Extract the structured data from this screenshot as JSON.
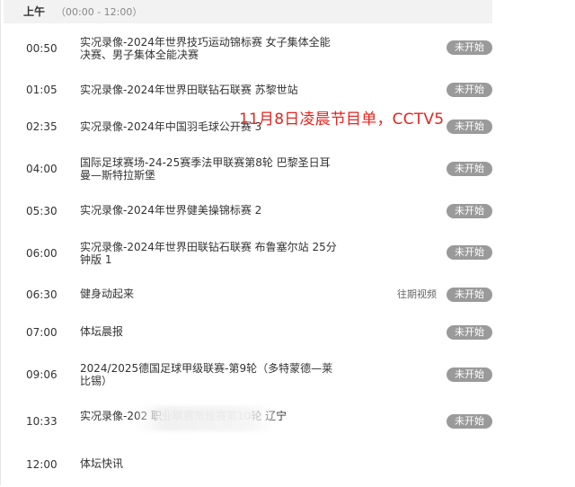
{
  "period": {
    "label": "上午",
    "range": "（00:00 - 12:00）"
  },
  "overlay_caption": "11月8日凌晨节目单，CCTV5",
  "programs": [
    {
      "time": "00:50",
      "title": "实况录像-2024年世界技巧运动锦标赛 女子集体全能决赛、男子集体全能决赛",
      "status": "未开始"
    },
    {
      "time": "01:05",
      "title": "实况录像-2024年世界田联钻石联赛 苏黎世站",
      "status": "未开始"
    },
    {
      "time": "02:35",
      "title": "实况录像-2024年中国羽毛球公开赛 3",
      "status": "未开始"
    },
    {
      "time": "04:00",
      "title": "国际足球赛场-24-25赛季法甲联赛第8轮 巴黎圣日耳曼—斯特拉斯堡",
      "status": "未开始"
    },
    {
      "time": "05:30",
      "title": "实况录像-2024年世界健美操锦标赛 2",
      "status": "未开始"
    },
    {
      "time": "06:00",
      "title": "实况录像-2024年世界田联钻石联赛 布鲁塞尔站 25分钟版 1",
      "status": "未开始"
    },
    {
      "time": "06:30",
      "title": "健身动起来",
      "replay": "往期视频",
      "status": "未开始"
    },
    {
      "time": "07:00",
      "title": "体坛晨报",
      "status": "未开始"
    },
    {
      "time": "09:06",
      "title": "2024/2025德国足球甲级联赛-第9轮（多特蒙德—莱比锡）",
      "status": "未开始"
    },
    {
      "time": "10:33",
      "title": "实况录像-202                          职业联赛常规赛第10轮 辽宁",
      "status": "未开始"
    },
    {
      "time": "12:00",
      "title": "体坛快讯"
    }
  ]
}
